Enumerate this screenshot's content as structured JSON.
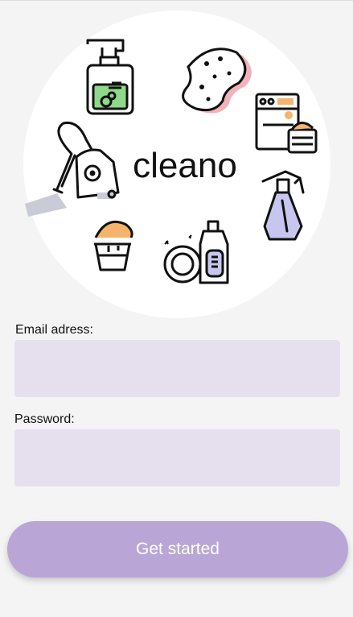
{
  "app": {
    "brand_name": "cleano"
  },
  "illustration": {
    "icons": [
      "soap-dispenser-icon",
      "sponge-icon",
      "washing-machine-icon",
      "vacuum-cleaner-icon",
      "spray-bottle-icon",
      "bucket-icon",
      "dish-soap-icon"
    ]
  },
  "form": {
    "email_label": "Email adress:",
    "email_value": "",
    "password_label": "Password:",
    "password_value": ""
  },
  "actions": {
    "get_started_label": "Get started"
  },
  "colors": {
    "background": "#f4f4f4",
    "field_fill": "#e6e0ee",
    "button": "#b9a6d6",
    "icon_green": "#8fd98b",
    "icon_pink": "#f2b3b8",
    "icon_orange": "#f4b46b",
    "icon_lavender": "#c7c6ef",
    "icon_grey": "#c9ccd6"
  }
}
